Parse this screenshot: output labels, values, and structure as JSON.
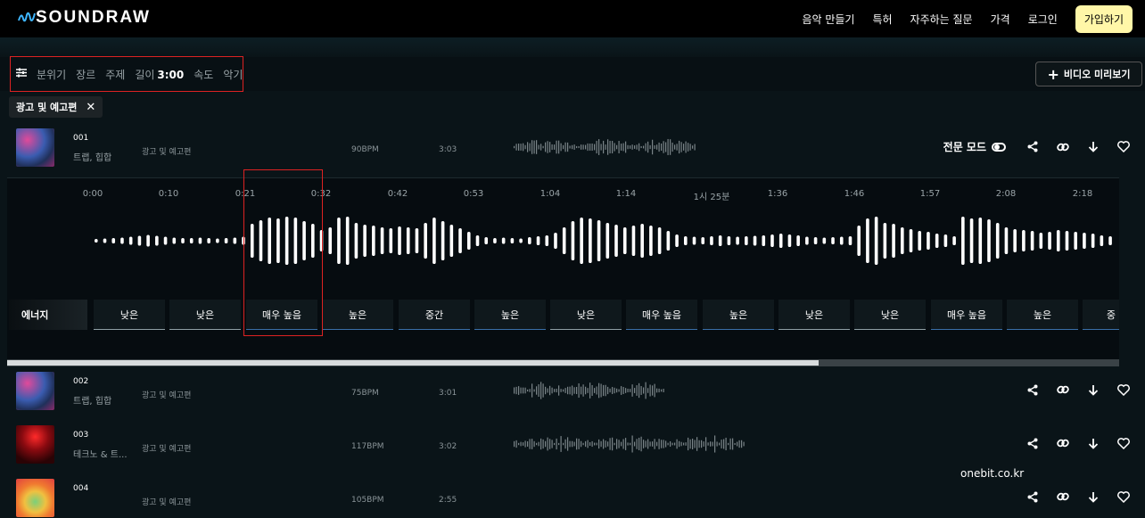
{
  "app": {
    "logo": "SOUNDRAW"
  },
  "nav": {
    "items": [
      "음악 만들기",
      "특허",
      "자주하는 질문",
      "가격",
      "로그인"
    ],
    "signup": "가입하기"
  },
  "filters": {
    "mood": "분위기",
    "genre": "장르",
    "theme": "주제",
    "length_label": "길이",
    "length_value": "3:00",
    "tempo": "속도",
    "instrument": "악기"
  },
  "video_preview": "비디오 미리보기",
  "active_chip": "광고 및 예고편",
  "expert_mode": "전문 모드",
  "tracks": [
    {
      "num": "001",
      "genre": "트랩, 힙합",
      "theme": "광고 및 예고편",
      "bpm": "90BPM",
      "duration": "3:03"
    },
    {
      "num": "002",
      "genre": "트랩, 힙합",
      "theme": "광고 및 예고편",
      "bpm": "75BPM",
      "duration": "3:01"
    },
    {
      "num": "003",
      "genre": "테크노 & 트...",
      "theme": "광고 및 예고편",
      "bpm": "117BPM",
      "duration": "3:02"
    },
    {
      "num": "004",
      "genre": "",
      "theme": "광고 및 예고편",
      "bpm": "105BPM",
      "duration": "2:55"
    }
  ],
  "timeline": [
    "0:00",
    "0:10",
    "0:21",
    "0:32",
    "0:42",
    "0:53",
    "1:04",
    "1:14",
    "1시 25분",
    "1:36",
    "1:46",
    "1:57",
    "2:08",
    "2:18"
  ],
  "energy_label": "에너지",
  "energy": [
    "낮은",
    "낮은",
    "매우 높음",
    "높은",
    "중간",
    "높은",
    "낮은",
    "매우 높음",
    "높은",
    "낮은",
    "낮은",
    "매우 높음",
    "높은",
    "중"
  ],
  "scroll_position": 0.73,
  "watermark": "onebit.co.kr",
  "colors": {
    "accent": "#fff7a8",
    "highlight": "#dd2222",
    "background": "#0a1418"
  },
  "icons": [
    "filter-sliders-icon",
    "plus-icon",
    "close-icon",
    "share-icon",
    "link-icon",
    "download-icon",
    "heart-icon",
    "toggle-icon"
  ]
}
